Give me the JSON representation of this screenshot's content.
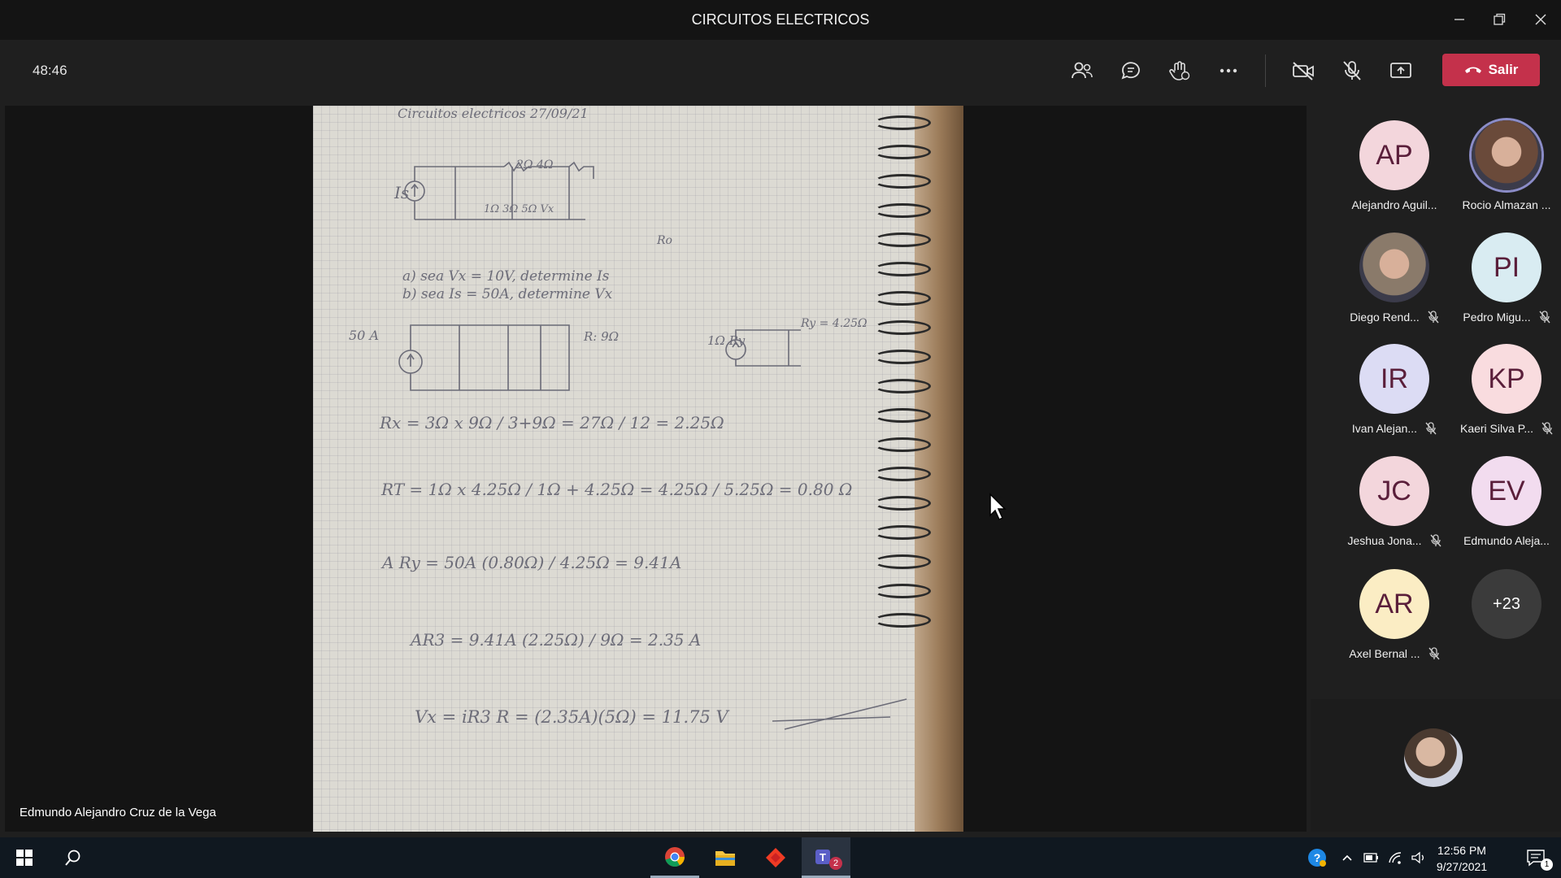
{
  "window": {
    "title": "CIRCUITOS ELECTRICOS"
  },
  "meeting": {
    "timer": "48:46",
    "leave_label": "Salir",
    "presenter_name": "Edmundo Alejandro Cruz de la Vega"
  },
  "notebook": {
    "lines": [
      "Circuitos  electricos   27/09/21",
      "Is",
      "2Ω      4Ω",
      "1Ω   3Ω   5Ω   Vx",
      "Ro",
      "a) sea  Vx = 10V, determine  Is",
      "b) sea  Is = 50A, determine  Vx",
      "50 A",
      "R: 9Ω",
      "1Ω    Ry",
      "Ry = 4.25Ω",
      "Rx = 3Ω x 9Ω / 3+9Ω = 27Ω / 12 = 2.25Ω",
      "RT = 1Ω x 4.25Ω / 1Ω + 4.25Ω = 4.25Ω / 5.25Ω = 0.80 Ω",
      "A Ry = 50A (0.80Ω) / 4.25Ω = 9.41A",
      "AR3 = 9.41A (2.25Ω) / 9Ω = 2.35 A",
      "Vx = iR3 R = (2.35A)(5Ω) = 11.75 V"
    ]
  },
  "participants": [
    {
      "initials": "AP",
      "name": "Alejandro Aguil...",
      "color": "#f3d6dc",
      "muted": false,
      "photo": false
    },
    {
      "initials": "",
      "name": "Rocio Almazan ...",
      "color": "#6a4a3a",
      "muted": false,
      "photo": true
    },
    {
      "initials": "",
      "name": "Diego Rend...",
      "color": "#8a7a6a",
      "muted": true,
      "photo": true
    },
    {
      "initials": "PI",
      "name": "Pedro Migu...",
      "color": "#d9ecf2",
      "muted": true,
      "photo": false
    },
    {
      "initials": "IR",
      "name": "Ivan Alejan...",
      "color": "#dcdcf4",
      "muted": true,
      "photo": false
    },
    {
      "initials": "KP",
      "name": "Kaeri Silva P...",
      "color": "#f9dcdf",
      "muted": true,
      "photo": false
    },
    {
      "initials": "JC",
      "name": "Jeshua Jona...",
      "color": "#f3d6dc",
      "muted": true,
      "photo": false
    },
    {
      "initials": "EV",
      "name": "Edmundo Aleja...",
      "color": "#f2dcef",
      "muted": false,
      "photo": false
    },
    {
      "initials": "AR",
      "name": "Axel Bernal ...",
      "color": "#fbedc4",
      "muted": true,
      "photo": false
    }
  ],
  "more_participants": "+23",
  "taskbar": {
    "time": "12:56 PM",
    "date": "9/27/2021",
    "teams_badge": "2",
    "notification_badge": "1"
  },
  "colors": {
    "leave": "#c4314b",
    "taskbar": "#101820",
    "accent": "#6264a7"
  }
}
